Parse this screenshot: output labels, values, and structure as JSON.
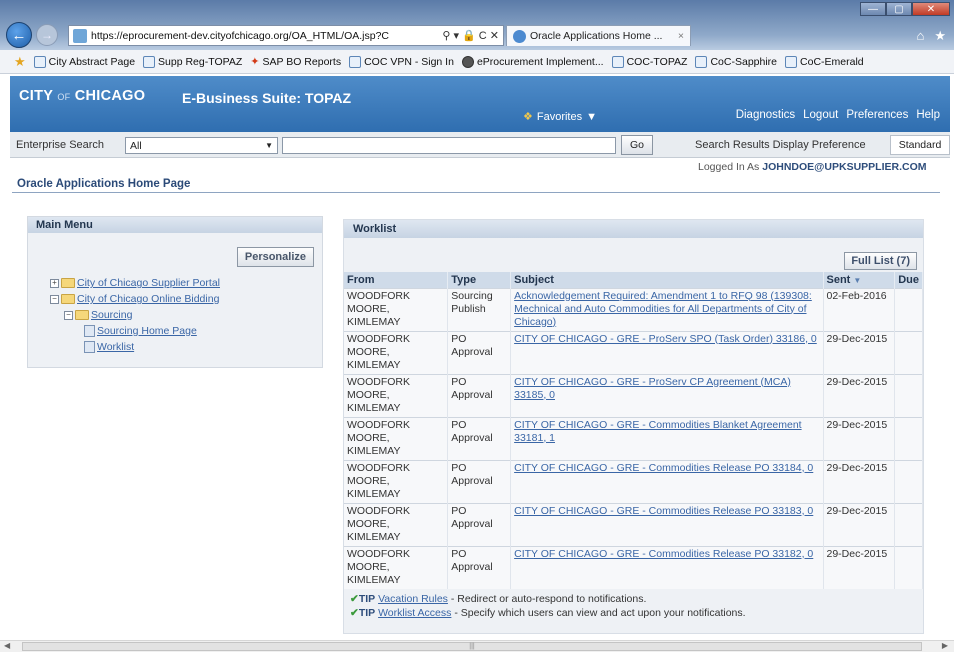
{
  "browser": {
    "address_url": "https://eprocurement-dev.cityofchicago.org/OA_HTML/OA.jsp?C",
    "address_controls": "⚲ ▾ 🔒 C ✕",
    "tab_title": "Oracle Applications Home ...",
    "tab_close": "×",
    "win_min": "—",
    "win_max": "▢",
    "win_close": "✕",
    "home_icon": "⌂",
    "star_icon": "★"
  },
  "favorites_bar": {
    "items": [
      {
        "label": "City Abstract Page",
        "icon": "page-icon"
      },
      {
        "label": "Supp Reg-TOPAZ",
        "icon": "page-icon"
      },
      {
        "label": "SAP BO Reports",
        "icon": "sap-icon"
      },
      {
        "label": "COC VPN - Sign In",
        "icon": "page-icon"
      },
      {
        "label": "eProcurement Implement...",
        "icon": "globe-icon"
      },
      {
        "label": "COC-TOPAZ",
        "icon": "page-icon"
      },
      {
        "label": "CoC-Sapphire",
        "icon": "page-icon"
      },
      {
        "label": "CoC-Emerald",
        "icon": "page-icon"
      }
    ]
  },
  "header": {
    "logo_city": "CITY",
    "logo_of": "OF",
    "logo_chicago": "CHICAGO",
    "suite_title": "E-Business Suite: TOPAZ",
    "favorites_label": "Favorites",
    "links": {
      "diagnostics": "Diagnostics",
      "logout": "Logout",
      "preferences": "Preferences",
      "help": "Help"
    }
  },
  "search": {
    "label": "Enterprise Search",
    "scope_value": "All",
    "query_value": "",
    "go_label": "Go",
    "pref_label": "Search Results Display Preference",
    "pref_value": "Standard"
  },
  "session": {
    "logged_prefix": "Logged In As",
    "user": "JOHNDOE@UPKSUPPLIER.COM"
  },
  "page_title": "Oracle Applications Home Page",
  "main_menu": {
    "title": "Main Menu",
    "personalize_label": "Personalize",
    "tree": {
      "supplier_portal": "City of Chicago Supplier Portal",
      "online_bidding": "City of Chicago Online Bidding",
      "sourcing": "Sourcing",
      "sourcing_home": "Sourcing Home Page",
      "worklist": "Worklist"
    }
  },
  "worklist": {
    "title": "Worklist",
    "full_list_label": "Full List (7)",
    "columns": {
      "from": "From",
      "type": "Type",
      "subject": "Subject",
      "sent": "Sent",
      "due": "Due"
    },
    "rows": [
      {
        "from": "WOODFORK MOORE, KIMLEMAY",
        "type": "Sourcing Publish",
        "subject": "Acknowledgement Required: Amendment 1 to RFQ 98 (139308: Mechnical and Auto Commodities for All Departments of City of Chicago)",
        "sent": "02-Feb-2016",
        "due": ""
      },
      {
        "from": "WOODFORK MOORE, KIMLEMAY",
        "type": "PO Approval",
        "subject": "CITY OF CHICAGO - GRE - ProServ SPO (Task Order) 33186, 0",
        "sent": "29-Dec-2015",
        "due": ""
      },
      {
        "from": "WOODFORK MOORE, KIMLEMAY",
        "type": "PO Approval",
        "subject": "CITY OF CHICAGO - GRE - ProServ CP Agreement (MCA) 33185, 0",
        "sent": "29-Dec-2015",
        "due": ""
      },
      {
        "from": "WOODFORK MOORE, KIMLEMAY",
        "type": "PO Approval",
        "subject": "CITY OF CHICAGO - GRE - Commodities Blanket Agreement 33181, 1",
        "sent": "29-Dec-2015",
        "due": ""
      },
      {
        "from": "WOODFORK MOORE, KIMLEMAY",
        "type": "PO Approval",
        "subject": "CITY OF CHICAGO - GRE - Commodities Release PO 33184, 0",
        "sent": "29-Dec-2015",
        "due": ""
      },
      {
        "from": "WOODFORK MOORE, KIMLEMAY",
        "type": "PO Approval",
        "subject": "CITY OF CHICAGO - GRE - Commodities Release PO 33183, 0",
        "sent": "29-Dec-2015",
        "due": ""
      },
      {
        "from": "WOODFORK MOORE, KIMLEMAY",
        "type": "PO Approval",
        "subject": "CITY OF CHICAGO - GRE - Commodities Release PO 33182, 0",
        "sent": "29-Dec-2015",
        "due": ""
      }
    ],
    "tips": [
      {
        "tag": "TIP",
        "link": "Vacation Rules",
        "text": " - Redirect or auto-respond to notifications."
      },
      {
        "tag": "TIP",
        "link": "Worklist Access",
        "text": " - Specify which users can view and act upon your notifications."
      }
    ]
  },
  "colors": {
    "header_blue": "#2f6eb0",
    "link_blue": "#3a66a6",
    "panel_bg": "#eef1f5"
  }
}
